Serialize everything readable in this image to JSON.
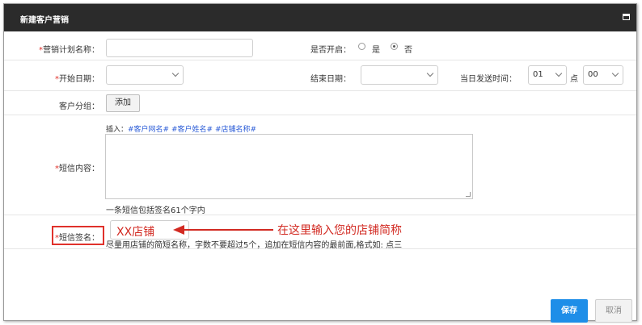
{
  "dialog": {
    "title": "新建客户营销"
  },
  "form": {
    "plan_name": {
      "required": "*",
      "label": "营销计划名称：",
      "value": ""
    },
    "enable": {
      "label": "是否开启：",
      "option_yes": "是",
      "option_no": "否",
      "selected": "否"
    },
    "start_date": {
      "required": "*",
      "label": "开始日期：",
      "value": ""
    },
    "end_date": {
      "label": "结束日期：",
      "value": ""
    },
    "send_time": {
      "label": "当日发送时间：",
      "hour": "01",
      "hour_unit": "点",
      "minute": "00"
    },
    "customer_group": {
      "label": "客户分组：",
      "add_label": "添加"
    },
    "sms_content": {
      "required": "*",
      "label": "短信内容：",
      "insert_prefix": "插入：",
      "insert_tags": [
        "#客户网名#",
        "#客户姓名#",
        "#店铺名称#"
      ],
      "value": "",
      "hint": "一条短信包括签名61个字内"
    },
    "sms_signature": {
      "required": "*",
      "label": "短信签名：",
      "value": "XX店铺",
      "hint": "尽量用店铺的简短名称，字数不要超过5个，追加在短信内容的最前面,格式如: 点三"
    }
  },
  "annotation": {
    "text": "在这里输入您的店铺简称",
    "color": "#d22a22"
  },
  "actions": {
    "save_label": "保存",
    "cancel_label": "取消"
  },
  "colors": {
    "accent": "#1e8ee8",
    "required": "#e0312b",
    "titlebar": "#2b2b2b"
  }
}
